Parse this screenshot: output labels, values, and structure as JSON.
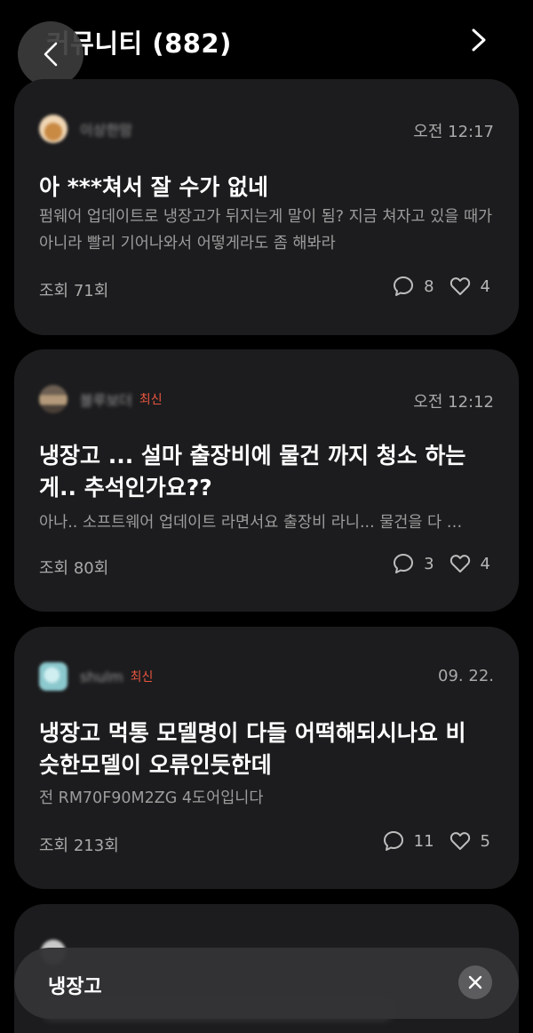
{
  "header": {
    "title": "커뮤니티 (882)",
    "back_icon": "chevron-left-icon",
    "next_icon": "chevron-right-icon"
  },
  "posts": [
    {
      "author": "이상한맘",
      "badge": "",
      "time": "오전 12:17",
      "title": "아 ***쳐서 잘 수가 없네",
      "excerpt": "펌웨어 업데이트로 냉장고가 뒤지는게 말이 됨?   지금 쳐자고 있을 때가 아니라 빨리 기어나와서 어떻게라도 좀 해봐라",
      "views": "조회 71회",
      "comments": "8",
      "likes": "4",
      "avatar_color": "#e8b07a"
    },
    {
      "author": "블루보더",
      "badge": "최신",
      "time": "오전 12:12",
      "title": "냉장고 ... 설마 출장비에 물건 까지 청소 하는게.. 추석인가요??",
      "excerpt": "아나..  소프트웨어 업데이트 라면서요  출장비 라니...  물건을 다 …",
      "views": "조회 80회",
      "comments": "3",
      "likes": "4",
      "avatar_color": "#8c7a64"
    },
    {
      "author": "shulm",
      "badge": "최신",
      "time": "09. 22.",
      "title": "냉장고 먹통 모델명이 다들 어떡해되시나요 비슷한모델이 오류인듯한데",
      "excerpt": "전 RM70F90M2ZG 4도어입니다",
      "views": "조회 213회",
      "comments": "11",
      "likes": "5",
      "avatar_color": "#9fd3d8"
    }
  ],
  "search": {
    "query": "냉장고",
    "clear_icon": "close-icon"
  },
  "colors": {
    "background": "#000000",
    "card": "#1c1c1e",
    "badge_new": "#e8553f",
    "muted_text": "#9c9c9c"
  }
}
